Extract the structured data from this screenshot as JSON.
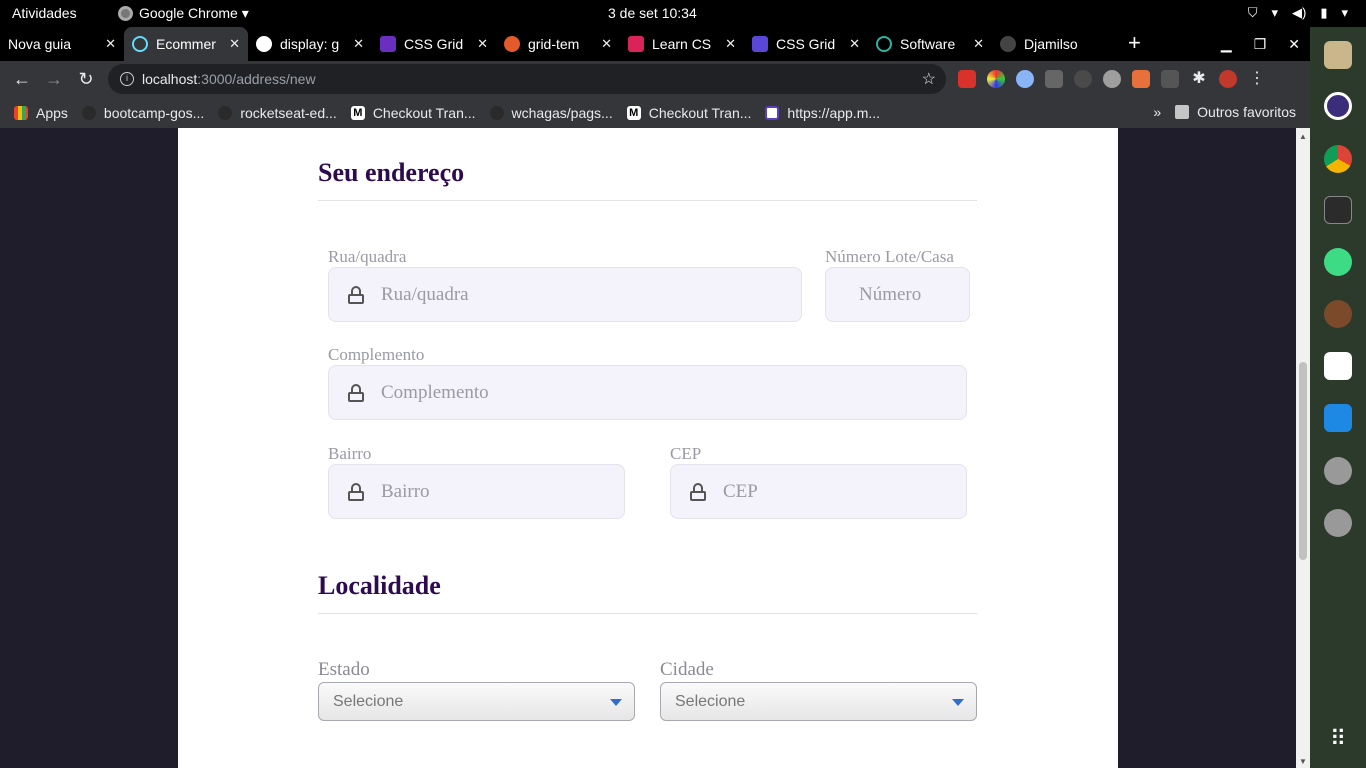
{
  "os": {
    "activities": "Atividades",
    "app_name": "Google Chrome ▾",
    "clock": "3 de set  10:34"
  },
  "tabs": [
    {
      "title": "Nova guia",
      "color": "#000000"
    },
    {
      "title": "Ecommer",
      "color": "#61dafb"
    },
    {
      "title": "display: g",
      "color": "#ffffff"
    },
    {
      "title": "CSS Grid",
      "color": "#6b2fbf"
    },
    {
      "title": "grid-tem",
      "color": "#e35a2b"
    },
    {
      "title": "Learn CS",
      "color": "#d9245a"
    },
    {
      "title": "CSS Grid",
      "color": "#5a47d6"
    },
    {
      "title": "Software",
      "color": "#2db3a0"
    },
    {
      "title": "Djamilso",
      "color": "#888888"
    }
  ],
  "address_bar": {
    "host": "localhost",
    "path": ":3000/address/new"
  },
  "bookmarks": [
    {
      "label": "Apps"
    },
    {
      "label": "bootcamp-gos..."
    },
    {
      "label": "rocketseat-ed..."
    },
    {
      "label": "Checkout Tran..."
    },
    {
      "label": "wchagas/pags..."
    },
    {
      "label": "Checkout Tran..."
    },
    {
      "label": "https://app.m..."
    }
  ],
  "bookmarks_overflow": "»",
  "other_bookmarks": "Outros favoritos",
  "form": {
    "section_address": "Seu endereço",
    "street_label": "Rua/quadra",
    "street_placeholder": "Rua/quadra",
    "number_label": "Número Lote/Casa",
    "number_placeholder": "Número",
    "complement_label": "Complemento",
    "complement_placeholder": "Complemento",
    "district_label": "Bairro",
    "district_placeholder": "Bairro",
    "cep_label": "CEP",
    "cep_placeholder": "CEP",
    "section_locality": "Localidade",
    "state_label": "Estado",
    "state_value": "Selecione",
    "city_label": "Cidade",
    "city_value": "Selecione"
  }
}
